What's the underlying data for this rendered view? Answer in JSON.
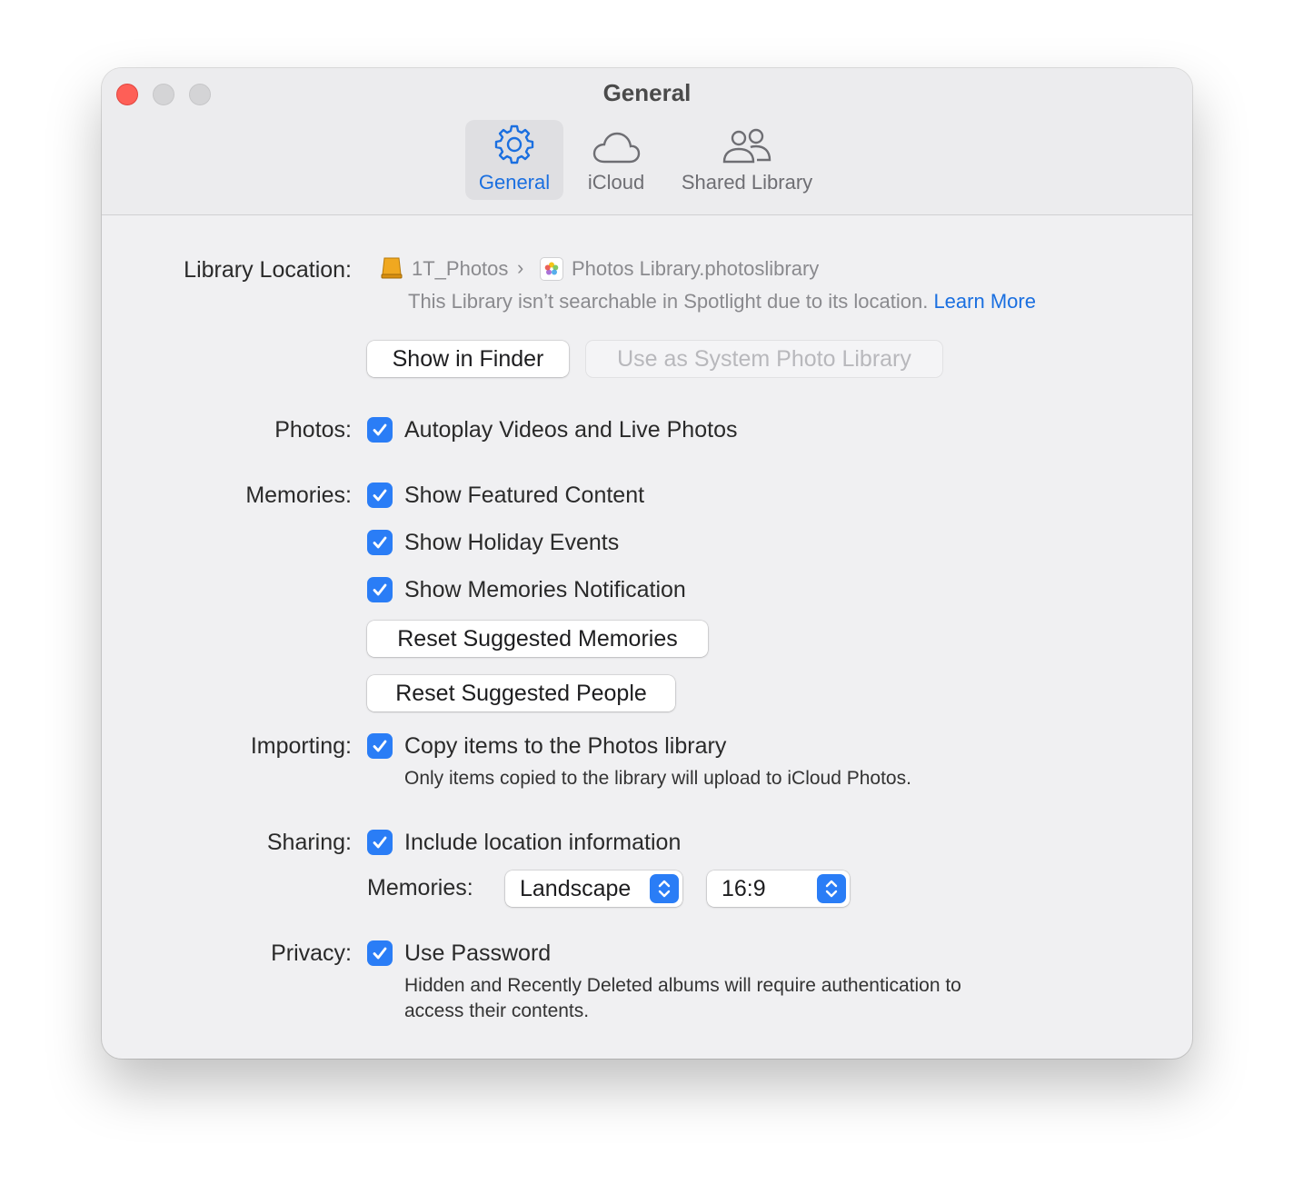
{
  "window": {
    "title": "General",
    "tabs": [
      {
        "label": "General",
        "icon": "gear-icon",
        "active": true
      },
      {
        "label": "iCloud",
        "icon": "cloud-icon",
        "active": false
      },
      {
        "label": "Shared Library",
        "icon": "people-icon",
        "active": false
      }
    ]
  },
  "library": {
    "label": "Library Location:",
    "drive": "1T_Photos",
    "separator": "›",
    "file": "Photos Library.photoslibrary",
    "note": "This Library isn’t searchable in Spotlight due to its location.",
    "learn_more": "Learn More",
    "show_in_finder": "Show in Finder",
    "use_as_system": "Use as System Photo Library"
  },
  "photos": {
    "label": "Photos:",
    "autoplay": "Autoplay Videos and Live Photos"
  },
  "memories": {
    "label": "Memories:",
    "featured": "Show Featured Content",
    "holiday": "Show Holiday Events",
    "notification": "Show Memories Notification",
    "reset_memories": "Reset Suggested Memories",
    "reset_people": "Reset Suggested People"
  },
  "importing": {
    "label": "Importing:",
    "copy": "Copy items to the Photos library",
    "note": "Only items copied to the library will upload to iCloud Photos."
  },
  "sharing": {
    "label": "Sharing:",
    "location": "Include location information",
    "memories_label": "Memories:",
    "orientation": "Landscape",
    "aspect": "16:9"
  },
  "privacy": {
    "label": "Privacy:",
    "password": "Use Password",
    "note_line1": "Hidden and Recently Deleted albums will require authentication to",
    "note_line2": "access their contents."
  },
  "colors": {
    "accent": "#2a7df6",
    "link": "#1a6fe0",
    "close": "#fe5f57"
  }
}
